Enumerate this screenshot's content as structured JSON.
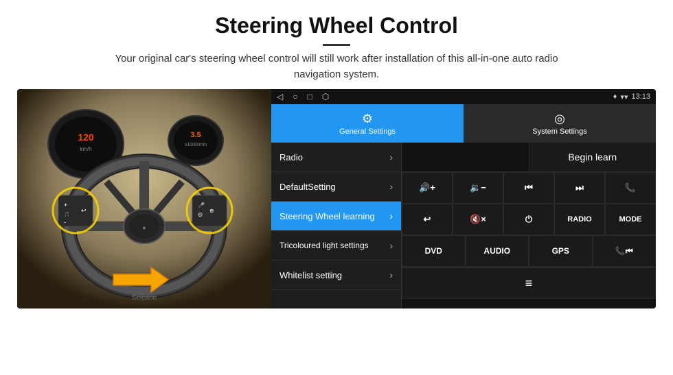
{
  "header": {
    "title": "Steering Wheel Control",
    "subtitle": "Your original car's steering wheel control will still work after installation of this all-in-one auto radio navigation system."
  },
  "status_bar": {
    "nav": [
      "◁",
      "○",
      "□",
      "⬡"
    ],
    "location_icon": "♦",
    "signal_icon": "▾",
    "time": "13:13"
  },
  "tabs": [
    {
      "label": "General Settings",
      "icon": "⚙",
      "active": true
    },
    {
      "label": "System Settings",
      "icon": "◎",
      "active": false
    }
  ],
  "menu": [
    {
      "label": "Radio",
      "chevron": "›",
      "active": false
    },
    {
      "label": "DefaultSetting",
      "chevron": "›",
      "active": false
    },
    {
      "label": "Steering Wheel learning",
      "chevron": "›",
      "active": true
    },
    {
      "label": "Tricoloured light settings",
      "chevron": "›",
      "active": false
    },
    {
      "label": "Whitelist setting",
      "chevron": "›",
      "active": false
    }
  ],
  "begin_learn": "Begin learn",
  "controls_row1": [
    {
      "symbol": "🔇+",
      "label": "vol_up"
    },
    {
      "symbol": "🔉-",
      "label": "vol_down"
    },
    {
      "symbol": "⏮",
      "label": "prev"
    },
    {
      "symbol": "⏭",
      "label": "next"
    },
    {
      "symbol": "📞",
      "label": "call"
    }
  ],
  "controls_row2": [
    {
      "symbol": "↩",
      "label": "back"
    },
    {
      "symbol": "🔇x",
      "label": "mute"
    },
    {
      "symbol": "⏻",
      "label": "power"
    },
    {
      "symbol": "RADIO",
      "label": "radio"
    },
    {
      "symbol": "MODE",
      "label": "mode"
    }
  ],
  "controls_row3": [
    {
      "symbol": "DVD",
      "label": "dvd"
    },
    {
      "symbol": "AUDIO",
      "label": "audio"
    },
    {
      "symbol": "GPS",
      "label": "gps"
    },
    {
      "symbol": "📞⏮",
      "label": "call_prev"
    }
  ],
  "controls_row4": [
    {
      "symbol": "≡",
      "label": "menu_icon"
    }
  ]
}
